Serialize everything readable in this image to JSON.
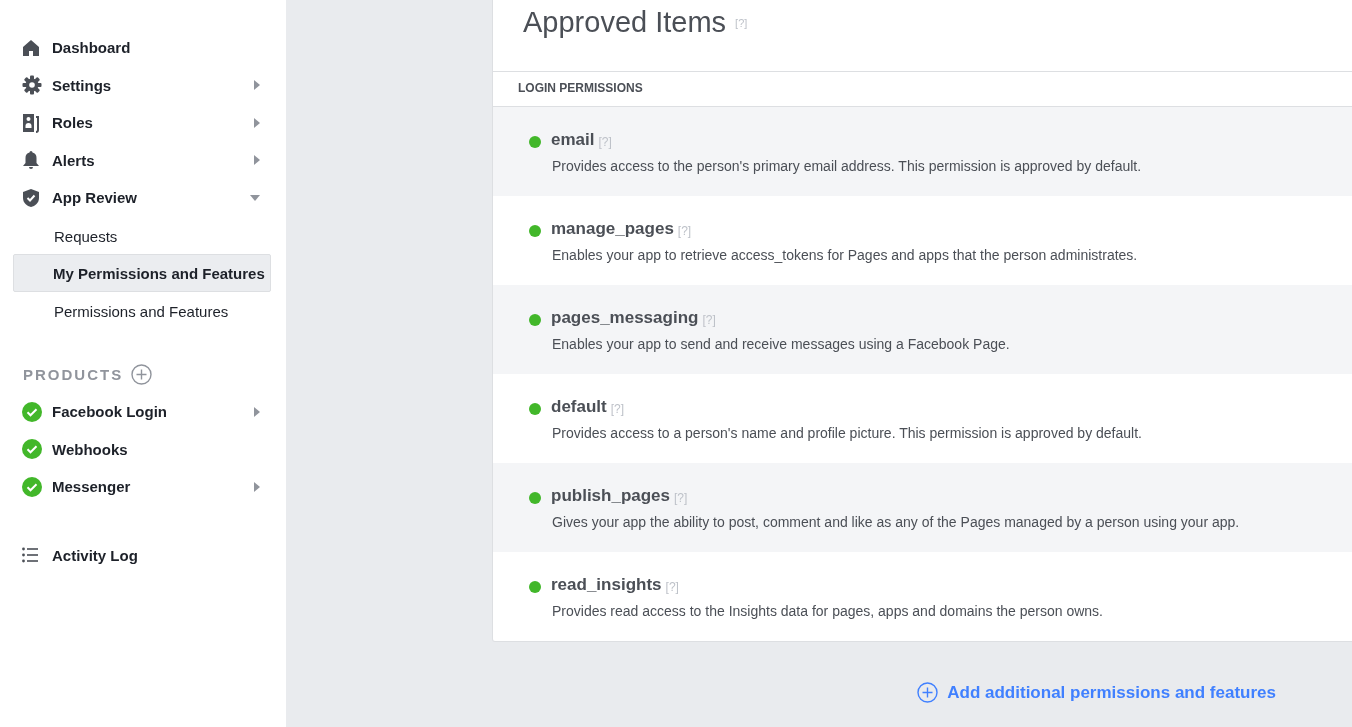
{
  "sidebar": {
    "items": [
      {
        "label": "Dashboard",
        "kind": "link"
      },
      {
        "label": "Settings",
        "kind": "group",
        "expanded": false
      },
      {
        "label": "Roles",
        "kind": "group",
        "expanded": false
      },
      {
        "label": "Alerts",
        "kind": "group",
        "expanded": false
      },
      {
        "label": "App Review",
        "kind": "group",
        "expanded": true,
        "children": [
          {
            "label": "Requests",
            "selected": false
          },
          {
            "label": "My Permissions and Features",
            "selected": true
          },
          {
            "label": "Permissions and Features",
            "selected": false
          }
        ]
      }
    ],
    "products": {
      "title": "PRODUCTS",
      "items": [
        {
          "label": "Facebook Login",
          "kind": "group",
          "expanded": false
        },
        {
          "label": "Webhooks",
          "kind": "link"
        },
        {
          "label": "Messenger",
          "kind": "group",
          "expanded": false
        }
      ]
    },
    "activity_log": {
      "label": "Activity Log"
    }
  },
  "main": {
    "title": "Approved Items",
    "title_help": "[?]",
    "section": "LOGIN PERMISSIONS",
    "permissions": [
      {
        "name": "email",
        "help": "[?]",
        "description": "Provides access to the person's primary email address. This permission is approved by default."
      },
      {
        "name": "manage_pages",
        "help": "[?]",
        "description": "Enables your app to retrieve access_tokens for Pages and apps that the person administrates."
      },
      {
        "name": "pages_messaging",
        "help": "[?]",
        "description": "Enables your app to send and receive messages using a Facebook Page."
      },
      {
        "name": "default",
        "help": "[?]",
        "description": "Provides access to a person's name and profile picture. This permission is approved by default."
      },
      {
        "name": "publish_pages",
        "help": "[?]",
        "description": "Gives your app the ability to post, comment and like as any of the Pages managed by a person using your app."
      },
      {
        "name": "read_insights",
        "help": "[?]",
        "description": "Provides read access to the Insights data for pages, apps and domains the person owns."
      }
    ],
    "add_link": "Add additional permissions and features"
  }
}
